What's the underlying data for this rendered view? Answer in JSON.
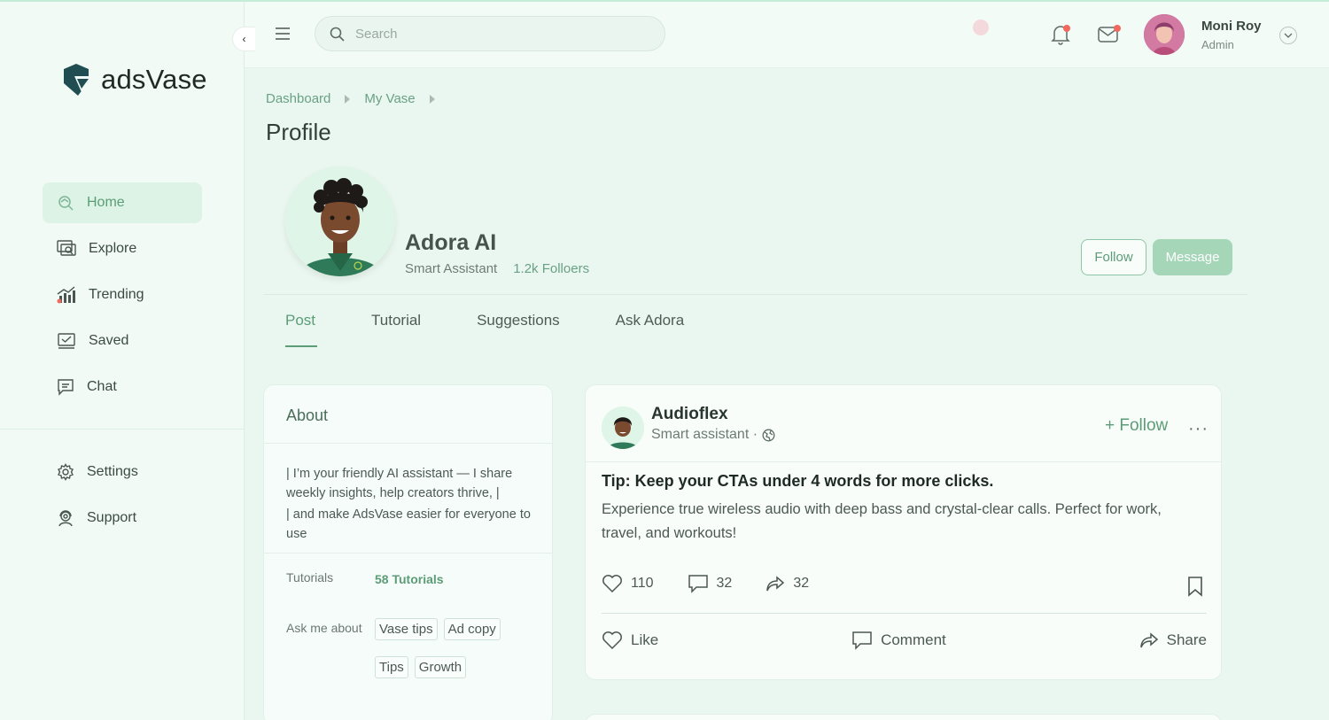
{
  "brand": {
    "name": "adsVase",
    "color": "#1f4d52"
  },
  "sidebar": {
    "collapse_icon": "chevron-left-icon",
    "items": [
      {
        "label": "Home",
        "icon": "home-search-icon",
        "active": true
      },
      {
        "label": "Explore",
        "icon": "explore-icon"
      },
      {
        "label": "Trending",
        "icon": "trending-chart-icon"
      },
      {
        "label": "Saved",
        "icon": "saved-check-icon"
      },
      {
        "label": "Chat",
        "icon": "chat-icon"
      }
    ],
    "bottom_items": [
      {
        "label": "Settings",
        "icon": "gear-icon"
      },
      {
        "label": "Support",
        "icon": "support-icon"
      }
    ]
  },
  "topbar": {
    "search_placeholder": "Search",
    "user": {
      "name": "Moni Roy",
      "role": "Admin"
    }
  },
  "breadcrumb": [
    "Dashboard",
    "My Vase"
  ],
  "page_title": "Profile",
  "profile": {
    "name": "Adora AI",
    "role": "Smart Assistant",
    "followers": "1.2k Folloers",
    "follow_label": "Follow",
    "message_label": "Message"
  },
  "tabs": [
    "Post",
    "Tutorial",
    "Suggestions",
    "Ask Adora"
  ],
  "active_tab": "Post",
  "about": {
    "title": "About",
    "line1": "| I’m your friendly AI assistant — I share weekly insights, help creators thrive, |",
    "line2": "| and make AdsVase easier for everyone to use",
    "tutorials_label": "Tutorials",
    "tutorials_value": "58 Tutorials",
    "ask_label": "Ask me about",
    "topics": [
      "Vase tips",
      "Ad copy",
      "Tips",
      "Growth"
    ]
  },
  "post": {
    "author": "Audioflex",
    "subtitle": "Smart assistant ·",
    "follow_label": "+ Follow",
    "more": "···",
    "heading": "Tip: Keep your CTAs under 4 words for more clicks.",
    "body": "Experience true wireless audio with deep bass and crystal-clear calls. Perfect for work, travel, and workouts!",
    "likes": "110",
    "comments": "32",
    "shares": "32",
    "actions": {
      "like": "Like",
      "comment": "Comment",
      "share": "Share"
    }
  },
  "colors": {
    "accent": "#5c9c77",
    "message_btn": "#a5d6b8",
    "badge": "#f2685f",
    "background": "#eaf7f0"
  }
}
